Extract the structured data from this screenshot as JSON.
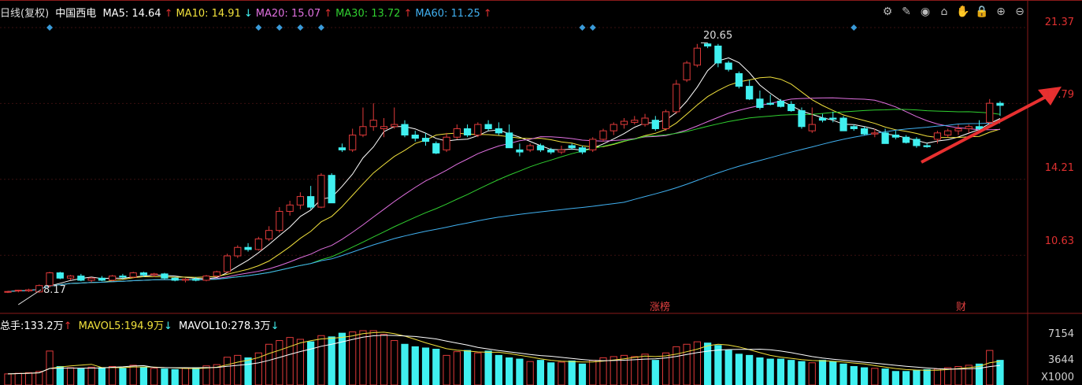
{
  "header": {
    "period": "日线(复权)",
    "stock": "中国西电",
    "ma": [
      {
        "label": "MA5:",
        "value": "14.64",
        "arrow": "↑",
        "color": "#ffffff"
      },
      {
        "label": "MA10:",
        "value": "14.91",
        "arrow": "↓",
        "color": "#f0e03c"
      },
      {
        "label": "MA20:",
        "value": "15.07",
        "arrow": "↑",
        "color": "#e070e0"
      },
      {
        "label": "MA30:",
        "value": "13.72",
        "arrow": "↑",
        "color": "#30d030"
      },
      {
        "label": "MA60:",
        "value": "11.25",
        "arrow": "↑",
        "color": "#40b0f0"
      }
    ]
  },
  "toolbar": {
    "icons": [
      "gear-icon",
      "pen-icon",
      "eye-icon",
      "basket-icon",
      "hand-icon",
      "lock-icon",
      "zoom-in-icon",
      "zoom-out-icon"
    ]
  },
  "price_axis": {
    "ticks": [
      "21.37",
      "17.79",
      "14.21",
      "10.63"
    ]
  },
  "volume_header": {
    "total_label": "总手:",
    "total_value": "133.2万",
    "total_arrow": "↑",
    "mavol5_label": "MAVOL5:",
    "mavol5_value": "194.9万",
    "mavol5_arrow": "↓",
    "mavol10_label": "MAVOL10:",
    "mavol10_value": "278.3万",
    "mavol10_arrow": "↓"
  },
  "volume_axis": {
    "ticks": [
      "7154",
      "3644"
    ],
    "unit": "X1000"
  },
  "annotations": {
    "high": "20.65",
    "low": "8.17",
    "limit_up_board": "涨榜",
    "financial": "财"
  },
  "colors": {
    "up": "#e03a3a",
    "down": "#40f0f0",
    "ma5": "#ffffff",
    "ma10": "#f0e03c",
    "ma20": "#e070e0",
    "ma30": "#30d030",
    "ma60": "#40b0f0",
    "arrow": "#e83030"
  },
  "chart_data": [
    {
      "type": "candlestick",
      "title": "",
      "ylim": [
        8.0,
        22.3
      ],
      "candles": [
        [
          8.9,
          8.95,
          8.85,
          8.92
        ],
        [
          8.95,
          9.0,
          8.88,
          8.98
        ],
        [
          8.95,
          9.05,
          8.9,
          9.0
        ],
        [
          8.9,
          9.25,
          8.85,
          9.2
        ],
        [
          9.2,
          9.85,
          9.1,
          9.8
        ],
        [
          9.8,
          9.85,
          9.5,
          9.55
        ],
        [
          9.55,
          9.7,
          9.45,
          9.65
        ],
        [
          9.65,
          9.75,
          9.4,
          9.45
        ],
        [
          9.45,
          9.6,
          9.35,
          9.55
        ],
        [
          9.55,
          9.65,
          9.4,
          9.45
        ],
        [
          9.45,
          9.7,
          9.4,
          9.65
        ],
        [
          9.65,
          9.75,
          9.5,
          9.6
        ],
        [
          9.6,
          9.85,
          9.55,
          9.8
        ],
        [
          9.8,
          9.85,
          9.6,
          9.7
        ],
        [
          9.7,
          9.8,
          9.6,
          9.75
        ],
        [
          9.75,
          9.8,
          9.5,
          9.55
        ],
        [
          9.55,
          9.6,
          9.4,
          9.45
        ],
        [
          9.45,
          9.55,
          9.35,
          9.5
        ],
        [
          9.5,
          9.6,
          9.4,
          9.45
        ],
        [
          9.45,
          9.7,
          9.4,
          9.65
        ],
        [
          9.65,
          9.9,
          9.6,
          9.85
        ],
        [
          9.85,
          10.7,
          9.8,
          10.6
        ],
        [
          10.6,
          11.1,
          10.5,
          11.0
        ],
        [
          11.0,
          11.2,
          10.8,
          10.9
        ],
        [
          10.9,
          11.5,
          10.85,
          11.4
        ],
        [
          11.4,
          12.0,
          11.3,
          11.8
        ],
        [
          11.8,
          12.9,
          11.7,
          12.7
        ],
        [
          12.7,
          13.2,
          12.5,
          13.0
        ],
        [
          13.0,
          13.6,
          12.8,
          13.4
        ],
        [
          13.4,
          13.9,
          12.8,
          12.9
        ],
        [
          12.9,
          14.5,
          12.85,
          14.4
        ],
        [
          14.4,
          14.5,
          13.1,
          13.1
        ],
        [
          15.7,
          15.9,
          15.5,
          15.6
        ],
        [
          15.6,
          16.6,
          15.5,
          16.3
        ],
        [
          16.3,
          17.6,
          16.2,
          16.7
        ],
        [
          16.7,
          17.8,
          16.5,
          17.0
        ],
        [
          16.6,
          17.1,
          16.2,
          16.7
        ],
        [
          16.7,
          17.6,
          16.6,
          16.8
        ],
        [
          16.8,
          17.0,
          16.2,
          16.3
        ],
        [
          16.3,
          16.5,
          16.0,
          16.15
        ],
        [
          16.15,
          16.4,
          15.8,
          16.0
        ],
        [
          15.9,
          16.0,
          15.4,
          15.45
        ],
        [
          15.6,
          16.4,
          15.5,
          16.2
        ],
        [
          16.2,
          16.8,
          16.1,
          16.6
        ],
        [
          16.6,
          16.8,
          16.2,
          16.3
        ],
        [
          16.3,
          16.9,
          16.2,
          16.8
        ],
        [
          16.8,
          17.0,
          16.5,
          16.6
        ],
        [
          16.6,
          16.9,
          16.3,
          16.4
        ],
        [
          16.4,
          16.8,
          15.7,
          15.7
        ],
        [
          15.6,
          15.9,
          15.3,
          15.5
        ],
        [
          15.6,
          15.9,
          15.5,
          15.8
        ],
        [
          15.8,
          15.9,
          15.5,
          15.6
        ],
        [
          15.6,
          15.7,
          15.4,
          15.5
        ],
        [
          15.5,
          15.8,
          15.4,
          15.6
        ],
        [
          15.8,
          15.9,
          15.6,
          15.7
        ],
        [
          15.7,
          15.8,
          15.4,
          15.5
        ],
        [
          15.6,
          16.2,
          15.5,
          16.1
        ],
        [
          16.1,
          16.6,
          16.0,
          16.5
        ],
        [
          16.5,
          16.9,
          16.3,
          16.8
        ],
        [
          16.8,
          17.1,
          16.6,
          16.95
        ],
        [
          16.9,
          17.2,
          16.8,
          17.0
        ],
        [
          16.8,
          17.3,
          16.7,
          17.1
        ],
        [
          17.0,
          17.2,
          16.5,
          16.6
        ],
        [
          16.6,
          17.5,
          16.5,
          17.4
        ],
        [
          17.4,
          18.9,
          17.3,
          18.7
        ],
        [
          18.9,
          19.8,
          18.8,
          19.7
        ],
        [
          19.6,
          20.6,
          19.5,
          20.4
        ],
        [
          20.6,
          20.65,
          20.4,
          20.5
        ],
        [
          20.5,
          20.6,
          19.5,
          19.7
        ],
        [
          19.7,
          19.8,
          19.3,
          19.4
        ],
        [
          19.2,
          19.3,
          18.5,
          18.6
        ],
        [
          18.6,
          18.9,
          17.95,
          18.0
        ],
        [
          18.0,
          18.4,
          17.5,
          17.6
        ],
        [
          17.8,
          18.2,
          17.7,
          17.75
        ],
        [
          17.9,
          18.0,
          17.6,
          17.65
        ],
        [
          17.75,
          17.9,
          17.4,
          17.45
        ],
        [
          17.45,
          17.6,
          16.6,
          16.7
        ],
        [
          16.5,
          17.6,
          16.4,
          16.8
        ],
        [
          17.1,
          17.3,
          16.9,
          17.0
        ],
        [
          17.1,
          17.4,
          16.9,
          17.05
        ],
        [
          17.1,
          17.2,
          16.5,
          16.5
        ],
        [
          16.7,
          16.8,
          16.5,
          16.6
        ],
        [
          16.6,
          16.7,
          16.3,
          16.35
        ],
        [
          16.35,
          16.6,
          16.2,
          16.4
        ],
        [
          16.4,
          16.6,
          15.9,
          15.9
        ],
        [
          16.3,
          16.5,
          16.1,
          16.2
        ],
        [
          16.2,
          16.3,
          15.9,
          15.95
        ],
        [
          16.1,
          16.2,
          15.7,
          15.8
        ],
        [
          15.8,
          15.9,
          15.7,
          15.75
        ],
        [
          16.1,
          16.5,
          15.9,
          16.4
        ],
        [
          16.3,
          16.6,
          16.2,
          16.5
        ],
        [
          16.5,
          16.8,
          16.3,
          16.6
        ],
        [
          16.6,
          16.8,
          16.4,
          16.7
        ],
        [
          16.7,
          17.0,
          16.5,
          16.6
        ],
        [
          16.9,
          18.0,
          16.8,
          17.8
        ],
        [
          17.8,
          17.9,
          17.2,
          17.7
        ]
      ]
    },
    {
      "type": "bar",
      "title": "",
      "series": [
        {
          "values": [
            18,
            19,
            20,
            22,
            55,
            30,
            28,
            26,
            29,
            28,
            30,
            27,
            32,
            29,
            27,
            26,
            25,
            27,
            28,
            31,
            33,
            45,
            48,
            44,
            52,
            66,
            72,
            77,
            74,
            70,
            80,
            78,
            84,
            86,
            88,
            88,
            82,
            72,
            66,
            62,
            60,
            58,
            48,
            54,
            56,
            52,
            55,
            48,
            44,
            42,
            38,
            40,
            36,
            37,
            39,
            34,
            40,
            44,
            46,
            48,
            46,
            50,
            40,
            52,
            62,
            66,
            70,
            68,
            64,
            56,
            50,
            48,
            44,
            42,
            42,
            40,
            38,
            36,
            40,
            38,
            34,
            30,
            28,
            27,
            26,
            22,
            22,
            24,
            25,
            26,
            28,
            30,
            32,
            34,
            56,
            40
          ]
        }
      ],
      "ylim": [
        0,
        88
      ]
    }
  ]
}
